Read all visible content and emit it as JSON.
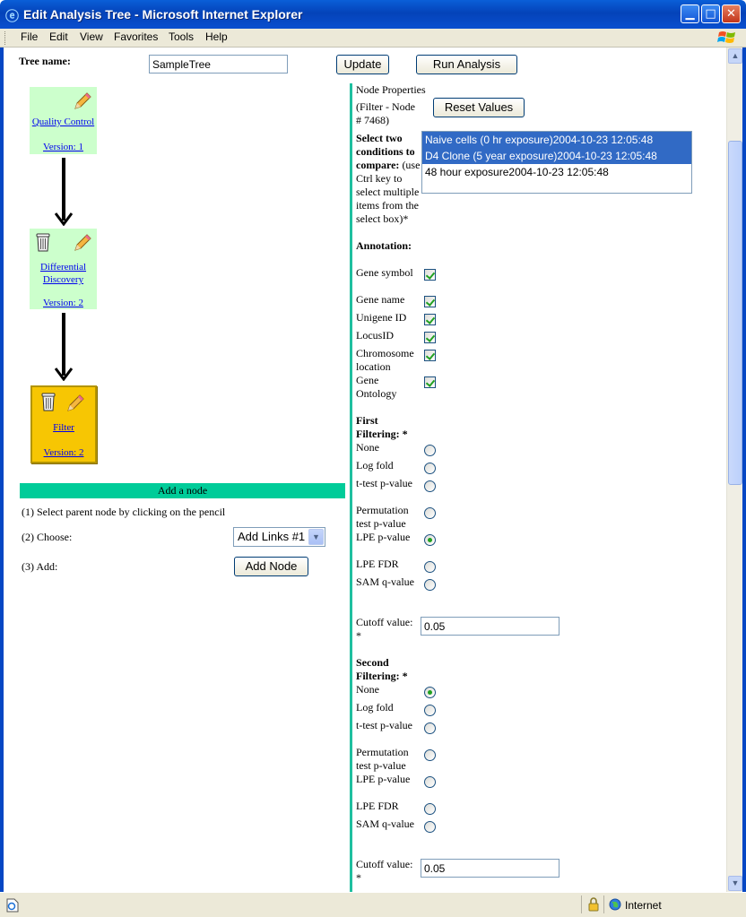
{
  "window": {
    "title": "Edit Analysis Tree - Microsoft Internet Explorer"
  },
  "menu": [
    "File",
    "Edit",
    "View",
    "Favorites",
    "Tools",
    "Help"
  ],
  "form": {
    "tree_name_label": "Tree name:",
    "tree_name_value": "SampleTree",
    "update_button": "Update",
    "run_button": "Run Analysis"
  },
  "tree": {
    "nodes": [
      {
        "name": "Quality Control",
        "version": "Version: 1"
      },
      {
        "name": "Differential Discovery",
        "version": "Version: 2"
      },
      {
        "name": "Filter",
        "version": "Version: 2"
      }
    ]
  },
  "add_node": {
    "header": "Add a node",
    "step1": "(1) Select parent node by clicking on the pencil",
    "step2": "(2) Choose:",
    "step3": "(3) Add:",
    "select_value": "Add Links #1",
    "add_button": "Add Node"
  },
  "props": {
    "heading": "Node Properties",
    "filter_node": "(Filter - Node # 7468)",
    "reset_button": "Reset Values",
    "select_label_bold": "Select two conditions to compare:",
    "select_label_rest": "(use Ctrl key to select multiple items from the select box)*",
    "conditions": [
      {
        "label": "Naive cells (0 hr exposure)2004-10-23 12:05:48",
        "selected": true
      },
      {
        "label": "D4 Clone (5 year exposure)2004-10-23 12:05:48",
        "selected": true
      },
      {
        "label": "48 hour exposure2004-10-23 12:05:48",
        "selected": false
      }
    ],
    "annotation_label": "Annotation:",
    "annotations": [
      {
        "label": "Gene symbol",
        "checked": true
      },
      {
        "label": "Gene name",
        "checked": true
      },
      {
        "label": "Unigene ID",
        "checked": true
      },
      {
        "label": "LocusID",
        "checked": true
      },
      {
        "label": "Chromosome location",
        "checked": true
      },
      {
        "label": "Gene Ontology",
        "checked": true
      }
    ],
    "first_filter_label": "First Filtering: *",
    "first_filter_options": [
      {
        "label": "None",
        "checked": false
      },
      {
        "label": "Log fold",
        "checked": false
      },
      {
        "label": "t-test p-value",
        "checked": false
      },
      {
        "label": "Permutation test p-value",
        "checked": false
      },
      {
        "label": "LPE p-value",
        "checked": true
      },
      {
        "label": "LPE FDR",
        "checked": false
      },
      {
        "label": "SAM q-value",
        "checked": false
      }
    ],
    "cutoff_label": "Cutoff value: *",
    "first_cutoff": "0.05",
    "second_filter_label": "Second Filtering: *",
    "second_filter_options": [
      {
        "label": "None",
        "checked": true
      },
      {
        "label": "Log fold",
        "checked": false
      },
      {
        "label": "t-test p-value",
        "checked": false
      },
      {
        "label": "Permutation test p-value",
        "checked": false
      },
      {
        "label": "LPE p-value",
        "checked": false
      },
      {
        "label": "LPE FDR",
        "checked": false
      },
      {
        "label": "SAM q-value",
        "checked": false
      }
    ],
    "second_cutoff": "0.05"
  },
  "status": {
    "zone": "Internet"
  }
}
